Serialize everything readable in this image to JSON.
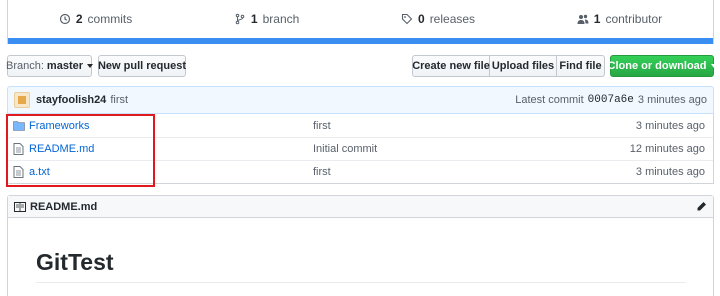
{
  "stats": {
    "commits_count": "2",
    "commits_label": "commits",
    "branch_count": "1",
    "branch_label": "branch",
    "releases_count": "0",
    "releases_label": "releases",
    "contributor_count": "1",
    "contributor_label": "contributor"
  },
  "toolbar": {
    "branch_prefix": "Branch:",
    "branch_name": "master",
    "new_pull_request": "New pull request",
    "create_new_file": "Create new file",
    "upload_files": "Upload files",
    "find_file": "Find file",
    "clone_or_download": "Clone or download"
  },
  "commit": {
    "author": "stayfoolish24",
    "message": "first",
    "latest_label": "Latest commit",
    "sha": "0007a6e",
    "age": "3 minutes ago"
  },
  "files": [
    {
      "name": "Frameworks",
      "type": "folder",
      "message": "first",
      "age": "3 minutes ago"
    },
    {
      "name": "README.md",
      "type": "file",
      "message": "Initial commit",
      "age": "12 minutes ago"
    },
    {
      "name": "a.txt",
      "type": "file",
      "message": "first",
      "age": "3 minutes ago"
    }
  ],
  "readme": {
    "header": "README.md",
    "title": "GitTest"
  },
  "colors": {
    "accent": "#0366d6",
    "language_bar": "#3a8ef2",
    "green": "#28a745",
    "highlight_box": "#e0191f"
  }
}
